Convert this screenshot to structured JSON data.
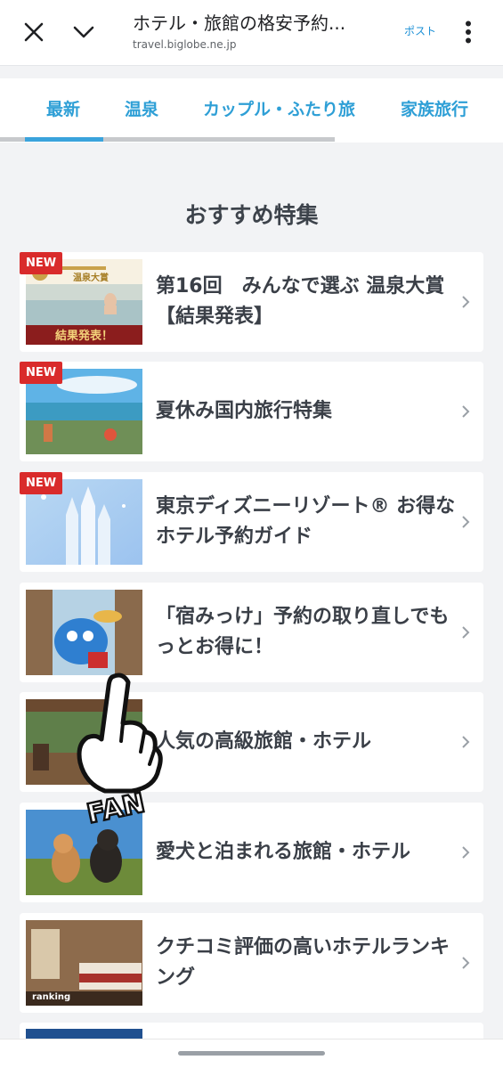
{
  "browser": {
    "title": "ホテル・旅館の格安予約...",
    "url": "travel.biglobe.ne.jp",
    "post_label": "ポスト",
    "icons": {
      "close": "close-icon",
      "collapse": "chevron-down-icon",
      "more": "more-vertical-icon"
    }
  },
  "tabs": [
    {
      "label": "最新",
      "active": true
    },
    {
      "label": "温泉",
      "active": false
    },
    {
      "label": "カップル・ふたり旅",
      "active": false
    },
    {
      "label": "家族旅行",
      "active": false
    }
  ],
  "tab_scroll": {
    "position": 0.07,
    "visible_fraction": 0.23
  },
  "section_title": "おすすめ特集",
  "cards": [
    {
      "title": "第16回　みんなで選ぶ 温泉大賞【結果発表】",
      "badge": "NEW",
      "thumb_caption": "結果発表！",
      "thumb_subtitle": "温泉大賞"
    },
    {
      "title": "夏休み国内旅行特集",
      "badge": "NEW"
    },
    {
      "title": "東京ディズニーリゾート® お得なホテル予約ガイド",
      "badge": "NEW"
    },
    {
      "title": "「宿みっけ」予約の取り直しでもっとお得に！",
      "badge": ""
    },
    {
      "title": "人気の高級旅館・ホテル",
      "badge": ""
    },
    {
      "title": "愛犬と泊まれる旅館・ホテル",
      "badge": ""
    },
    {
      "title": "クチコミ評価の高いホテルランキング",
      "badge": "",
      "thumb_caption": "ranking"
    }
  ],
  "sticker_text": "FAN",
  "colors": {
    "accent": "#2e9fd6",
    "badge": "#d92b2b",
    "background": "#f2f3f5"
  }
}
